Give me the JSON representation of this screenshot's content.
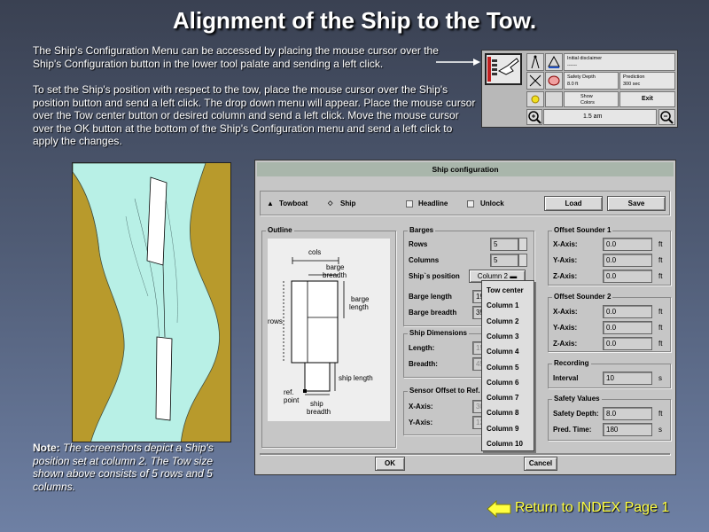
{
  "title": "Alignment of the Ship to the Tow.",
  "intro_paragraph": "The Ship's Configuration Menu can be accessed by placing the mouse cursor over the Ship's Configuration button in the lower tool palate and sending a left click.",
  "instructions_paragraph": "To set the Ship's position with respect to the tow, place the mouse cursor over the Ship's position button and send a left click.  The drop down menu will appear.  Place the mouse cursor over the Tow center button or desired column and send a left click.  Move the mouse cursor over the OK button at the bottom of the Ship's Configuration menu and send a left click to apply the changes.",
  "note": {
    "label": "Note:",
    "text": "The screenshots depict a Ship's position set at column 2.  The Tow size shown above consists of 5 rows and 5 columns."
  },
  "return_link": "Return to INDEX Page 1",
  "toolbar": {
    "initial_disclaimer": "Initial disclaimer",
    "initial_value": "------",
    "safety_depth_label": "Safety Depth",
    "safety_depth_value": "8.0 ft",
    "prediction_label": "Prediction",
    "prediction_value": "300 sec",
    "show_label": "Show",
    "colors_label": "Colors",
    "exit_label": "Exit",
    "zoom_value": "1.5 am"
  },
  "outline_labels": {
    "cols": "cols",
    "barge_breadth_1": "barge",
    "barge_breadth_2": "breadth",
    "barge_length_1": "barge",
    "barge_length_2": "length",
    "rows": "rows",
    "ship_length": "ship length",
    "ref_point_1": "ref.",
    "ref_point_2": "point",
    "ship_breadth_1": "ship",
    "ship_breadth_2": "breadth"
  },
  "dialog": {
    "title": "Ship configuration",
    "towboat_label": "Towboat",
    "ship_label": "Ship",
    "headline_label": "Headline",
    "unlock_label": "Unlock",
    "load_button": "Load",
    "save_button": "Save",
    "outline_group": "Outline",
    "barges_group": "Barges",
    "rows_label": "Rows",
    "rows_value": "5",
    "columns_label": "Columns",
    "columns_value": "5",
    "ship_position_label": "Ship`s position",
    "ship_position_value": "Column 2",
    "barge_length_label": "Barge length",
    "barge_length_value": "19",
    "barge_breadth_label": "Barge breadth",
    "barge_breadth_value": "35",
    "ship_dimensions_group": "Ship Dimensions",
    "length_label": "Length:",
    "length_value": "15",
    "breadth_label": "Breadth:",
    "breadth_value": "45",
    "sensor_offset_group": "Sensor Offset to Ref. P",
    "sensor_x_label": "X-Axis:",
    "sensor_x_value": "30",
    "sensor_y_label": "Y-Axis:",
    "sensor_y_value": "12",
    "offset1_group": "Offset Sounder 1",
    "off1_x_label": "X-Axis:",
    "off1_x_value": "0.0",
    "off1_y_label": "Y-Axis:",
    "off1_y_value": "0.0",
    "off1_z_label": "Z-Axis:",
    "off1_z_value": "0.0",
    "offset2_group": "Offset Sounder 2",
    "off2_x_label": "X-Axis:",
    "off2_x_value": "0.0",
    "off2_y_label": "Y-Axis:",
    "off2_y_value": "0.0",
    "off2_z_label": "Z-Axis:",
    "off2_z_value": "0.0",
    "recording_group": "Recording",
    "interval_label": "Interval",
    "interval_value": "10",
    "safety_values_group": "Safety Values",
    "safety_depth_label": "Safety Depth:",
    "safety_depth_value": "8.0",
    "pred_time_label": "Pred. Time:",
    "pred_time_value": "180",
    "unit_ft": "ft",
    "unit_s": "s",
    "ok_button": "OK",
    "cancel_button": "Cancel"
  },
  "dropdown_items": [
    "Tow center",
    "Column 1",
    "Column 2",
    "Column 3",
    "Column 4",
    "Column 5",
    "Column 6",
    "Column 7",
    "Column 8",
    "Column 9",
    "Column 10"
  ],
  "colors": {
    "accent_yellow": "#ffff40",
    "river_water": "#b8f0e6",
    "river_bank": "#b89a2c",
    "dialog_bg": "#c6c6c6"
  }
}
